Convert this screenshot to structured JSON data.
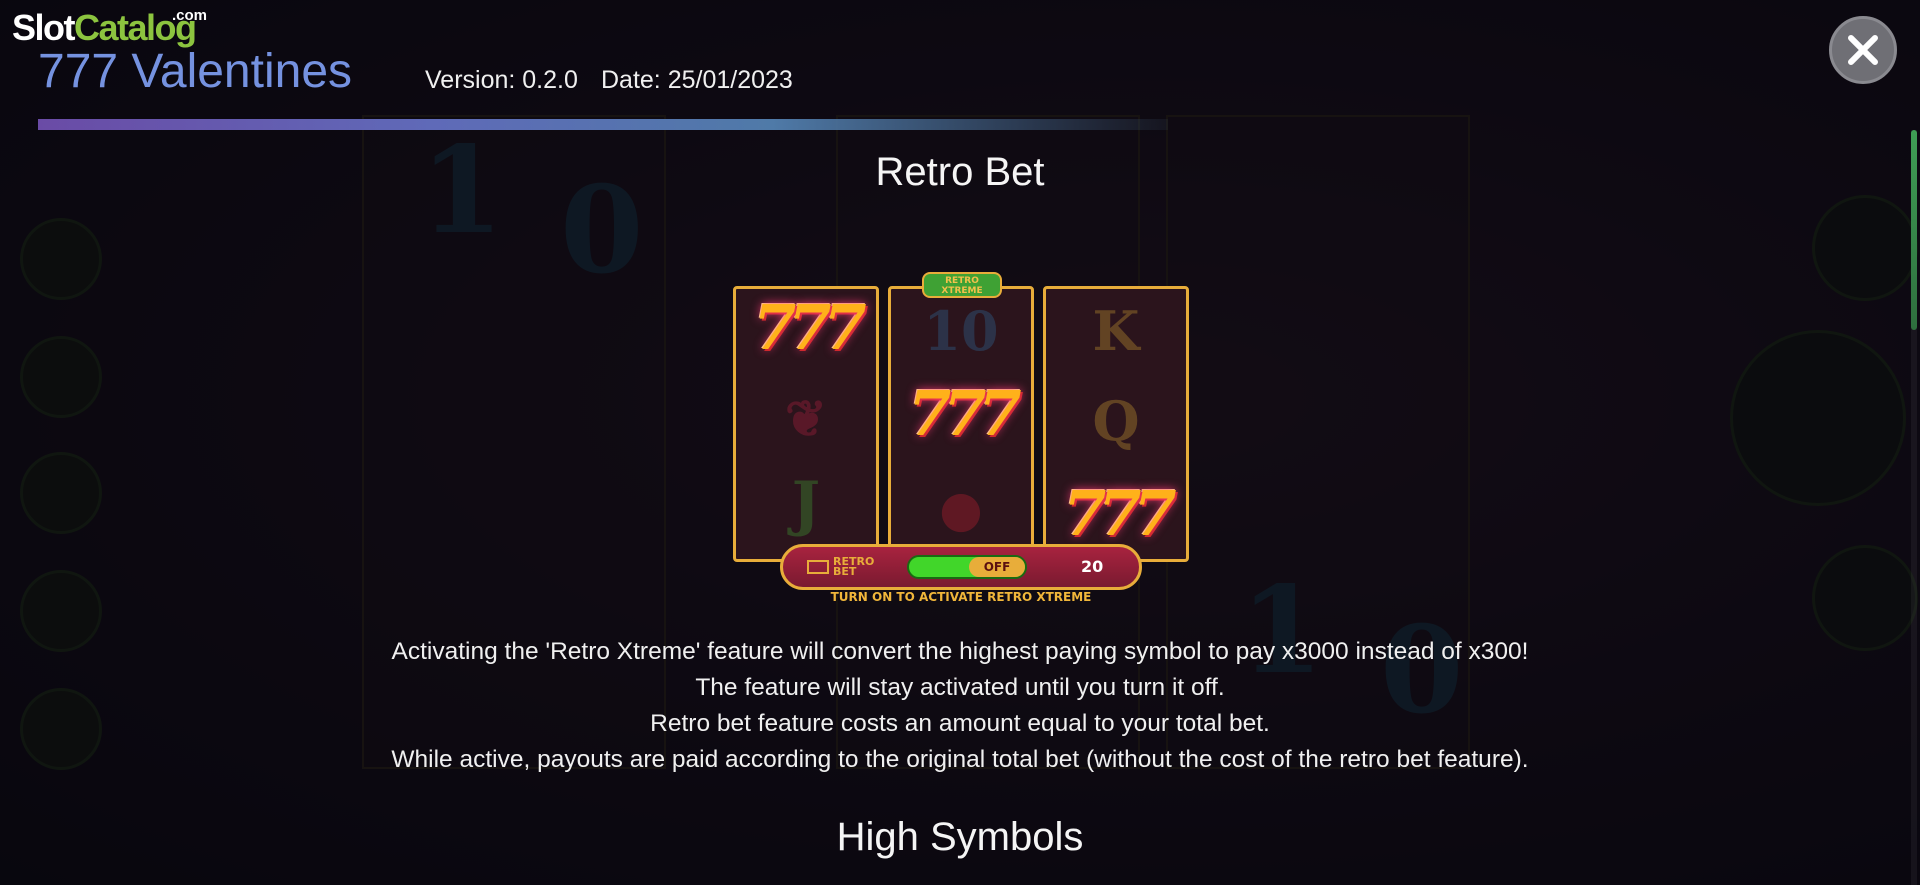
{
  "logo": {
    "slot": "Slot",
    "catalog": "Catalog",
    "com": ".com"
  },
  "header": {
    "game_title": "777 Valentines",
    "version": "Version: 0.2.0",
    "date": "Date: 25/01/2023"
  },
  "colors": {
    "accent": "#7592e0",
    "logo_green": "#8cc43f",
    "gold": "#e8ad3a",
    "toggle_green": "#41d62a"
  },
  "icons": {
    "close": "close-icon"
  },
  "sections": [
    {
      "title": "Retro Bet",
      "illustration": {
        "badge_line1": "RETRO",
        "badge_line2": "XTREME",
        "toggle_label_line1": "RETRO",
        "toggle_label_line2": "BET",
        "toggle_state": "OFF",
        "toggle_value": "20",
        "caption": "TURN ON TO ACTIVATE RETRO XTREME",
        "reels": [
          [
            "777",
            "gift",
            "J"
          ],
          [
            "10",
            "777",
            "cherry"
          ],
          [
            "K",
            "Q",
            "777"
          ]
        ]
      },
      "paragraphs": [
        "Activating the 'Retro Xtreme' feature will convert the highest paying symbol to pay x3000 instead of x300!",
        "The feature will stay activated until you turn it off.",
        "Retro bet feature costs an amount equal to your total bet.",
        "While active, payouts are paid according to the original total bet (without the cost of the retro bet feature)."
      ]
    },
    {
      "title": "High Symbols"
    }
  ]
}
